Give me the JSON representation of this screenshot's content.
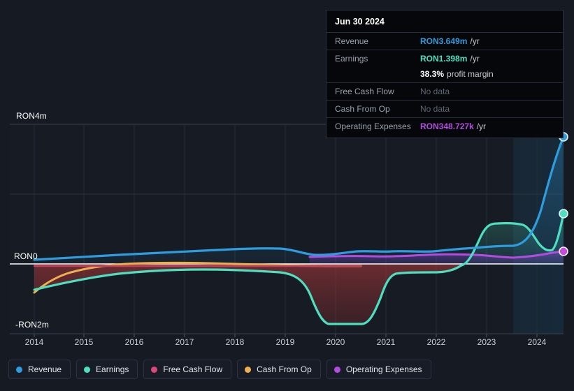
{
  "tooltip": {
    "date": "Jun 30 2024",
    "rows": [
      {
        "key": "Revenue",
        "value": "RON3.649m",
        "suffix": "/yr",
        "color": "#2e9ddf",
        "nodata": false
      },
      {
        "key": "Earnings",
        "value": "RON1.398m",
        "suffix": "/yr",
        "color": "#4ce0c0",
        "nodata": false
      },
      {
        "key": "",
        "value": "38.3%",
        "suffix": "profit margin",
        "color": "#ffffff",
        "nodata": false,
        "margin_row": true
      },
      {
        "key": "Free Cash Flow",
        "value": "No data",
        "suffix": "",
        "color": "#5e6673",
        "nodata": true
      },
      {
        "key": "Cash From Op",
        "value": "No data",
        "suffix": "",
        "color": "#5e6673",
        "nodata": true
      },
      {
        "key": "Operating Expenses",
        "value": "RON348.727k",
        "suffix": "/yr",
        "color": "#b44ce0",
        "nodata": false
      }
    ]
  },
  "axis": {
    "y_top_label": "RON4m",
    "y_zero_label": "RON0",
    "y_bottom_label": "-RON2m",
    "y_ticks": [
      4000000,
      2000000,
      0,
      -2000000
    ],
    "ylim": [
      -2000000,
      4000000
    ],
    "x_labels": [
      "2014",
      "2015",
      "2016",
      "2017",
      "2018",
      "2019",
      "2020",
      "2021",
      "2022",
      "2023",
      "2024"
    ]
  },
  "legend": {
    "items": [
      {
        "label": "Revenue",
        "color": "#2e9ddf"
      },
      {
        "label": "Earnings",
        "color": "#4ce0c0"
      },
      {
        "label": "Free Cash Flow",
        "color": "#e0457b"
      },
      {
        "label": "Cash From Op",
        "color": "#eeb04e"
      },
      {
        "label": "Operating Expenses",
        "color": "#b44ce0"
      }
    ]
  },
  "chart_data": {
    "type": "line",
    "title": "",
    "xlabel": "",
    "ylabel": "RON",
    "ylim": [
      -2000000,
      4000000
    ],
    "grid": true,
    "legend_position": "bottom",
    "currency": "RON",
    "forecast_start_x": 2023.45,
    "x_domain": [
      2013.7,
      2024.85
    ],
    "x": [
      2013.7,
      2014,
      2014.5,
      2015,
      2015.5,
      2016,
      2016.5,
      2017,
      2017.5,
      2018,
      2018.5,
      2019,
      2019.3,
      2019.6,
      2019.9,
      2020.2,
      2020.5,
      2020.8,
      2021,
      2021.3,
      2021.6,
      2022,
      2022.4,
      2022.8,
      2023,
      2023.3,
      2023.6,
      2023.9,
      2024.2,
      2024.5,
      2024.85
    ],
    "series": [
      {
        "name": "Revenue",
        "color": "#2e9ddf",
        "values": [
          120000,
          130000,
          150000,
          170000,
          185000,
          195000,
          205000,
          215000,
          230000,
          250000,
          270000,
          275000,
          250000,
          245000,
          250000,
          280000,
          300000,
          295000,
          300000,
          290000,
          285000,
          300000,
          310000,
          330000,
          360000,
          330000,
          300000,
          500000,
          1300000,
          2600000,
          3649000
        ],
        "end_marker": true,
        "end_value": 3649000
      },
      {
        "name": "Earnings",
        "color": "#4ce0c0",
        "values": [
          -750000,
          -690000,
          -560000,
          -470000,
          -410000,
          -380000,
          -370000,
          -365000,
          -370000,
          -390000,
          -420000,
          -400000,
          -430000,
          -1700000,
          -1760000,
          -1760000,
          -1740000,
          -1300000,
          -380000,
          -340000,
          -330000,
          -330000,
          -340000,
          -50000,
          700000,
          760000,
          740000,
          300000,
          130000,
          400000,
          1398000
        ],
        "end_marker": true,
        "end_value": 1398000
      },
      {
        "name": "Free Cash Flow",
        "color": "#e0457b",
        "x_range": [
          2013.7,
          2020.7
        ],
        "values": [
          -60000,
          -55000,
          -50000,
          -48000,
          -46000,
          -44000,
          -42000,
          -40000,
          -38000,
          -36000,
          -34000,
          -32000,
          -30000,
          -30000,
          -30000,
          -30000,
          -30000,
          null,
          null,
          null,
          null,
          null,
          null,
          null,
          null,
          null,
          null,
          null,
          null,
          null,
          null
        ],
        "end_marker": false
      },
      {
        "name": "Cash From Op",
        "color": "#eeb04e",
        "x_range": [
          2013.7,
          2020.7
        ],
        "values": [
          -820000,
          -700000,
          -480000,
          -330000,
          -250000,
          -215000,
          -200000,
          -195000,
          -200000,
          -215000,
          -230000,
          -225000,
          -230000,
          -240000,
          -250000,
          -255000,
          -250000,
          null,
          null,
          null,
          null,
          null,
          null,
          null,
          null,
          null,
          null,
          null,
          null,
          null,
          null
        ],
        "end_marker": false
      },
      {
        "name": "Operating Expenses",
        "color": "#b44ce0",
        "x_range": [
          2019.55,
          2024.85
        ],
        "values": [
          null,
          null,
          null,
          null,
          null,
          null,
          null,
          null,
          null,
          null,
          null,
          null,
          null,
          195000,
          200000,
          205000,
          210000,
          215000,
          225000,
          230000,
          215000,
          200000,
          205000,
          215000,
          225000,
          230000,
          215000,
          225000,
          250000,
          310000,
          348727
        ],
        "end_marker": true,
        "end_value": 348727
      }
    ]
  }
}
